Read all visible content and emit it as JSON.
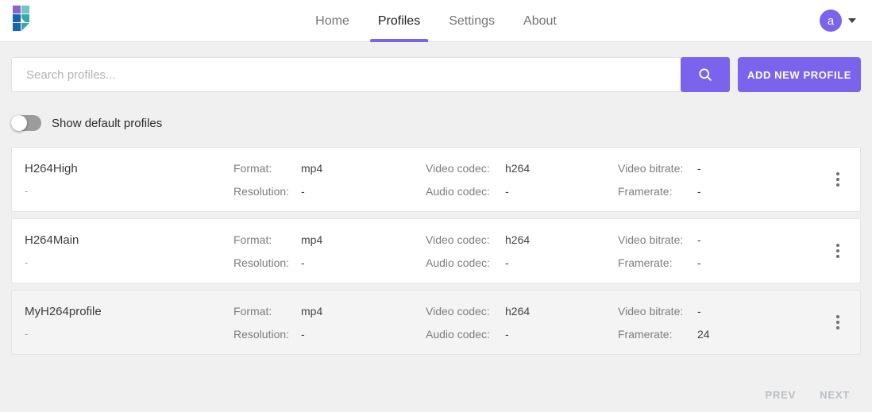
{
  "header": {
    "nav": [
      {
        "label": "Home",
        "active": false
      },
      {
        "label": "Profiles",
        "active": true
      },
      {
        "label": "Settings",
        "active": false
      },
      {
        "label": "About",
        "active": false
      }
    ],
    "avatar_letter": "a"
  },
  "search": {
    "placeholder": "Search profiles...",
    "value": "",
    "add_button_label": "ADD NEW PROFILE"
  },
  "toggle": {
    "label": "Show default profiles",
    "state": "off"
  },
  "field_labels": {
    "format": "Format:",
    "resolution": "Resolution:",
    "video_codec": "Video codec:",
    "audio_codec": "Audio codec:",
    "video_bitrate": "Video bitrate:",
    "framerate": "Framerate:"
  },
  "profiles": [
    {
      "name": "H264High",
      "subtitle": "-",
      "format": "mp4",
      "resolution": "-",
      "video_codec": "h264",
      "audio_codec": "-",
      "video_bitrate": "-",
      "framerate": "-",
      "highlighted": false
    },
    {
      "name": "H264Main",
      "subtitle": "-",
      "format": "mp4",
      "resolution": "-",
      "video_codec": "h264",
      "audio_codec": "-",
      "video_bitrate": "-",
      "framerate": "-",
      "highlighted": false
    },
    {
      "name": "MyH264profile",
      "subtitle": "-",
      "format": "mp4",
      "resolution": "-",
      "video_codec": "h264",
      "audio_codec": "-",
      "video_bitrate": "-",
      "framerate": "24",
      "highlighted": true
    }
  ],
  "pagination": {
    "prev": "PREV",
    "next": "NEXT"
  },
  "colors": {
    "accent": "#7b63ee",
    "highlight_card_bg": "#f4f4f4",
    "logo_purple": "#8a63c9",
    "logo_blue": "#1565b0",
    "logo_teal_light": "#6fc5c3",
    "logo_teal": "#35a9a4"
  }
}
